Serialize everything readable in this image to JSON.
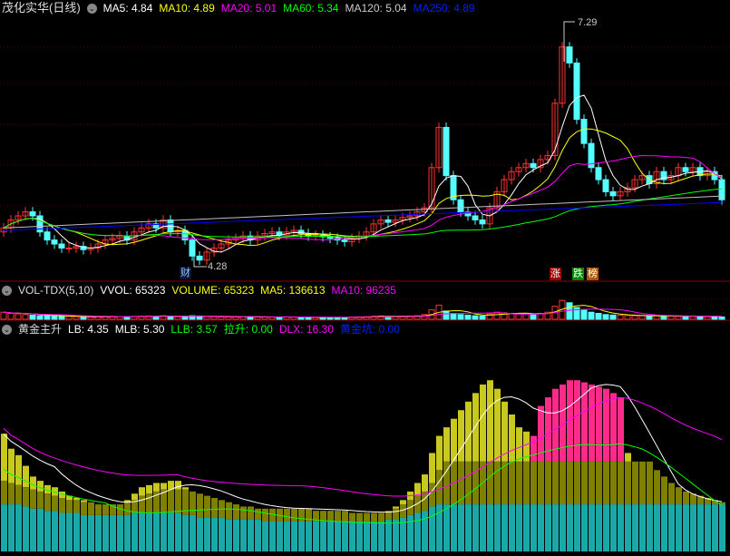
{
  "header": {
    "title": "茂化实华(日线)",
    "ma5": "MA5: 4.84",
    "ma10": "MA10: 4.89",
    "ma20": "MA20: 5.01",
    "ma60": "MA60: 5.34",
    "ma120": "MA120: 5.04",
    "ma250": "MA250: 4.89"
  },
  "vol_header": {
    "name": "VOL-TDX(5,10)",
    "vvol": "VVOL: 65323",
    "volume": "VOLUME: 65323",
    "ma5": "MA5: 136613",
    "ma10": "MA10: 96235"
  },
  "ind_header": {
    "name": "黄金主升",
    "lb": "LB: 4.35",
    "mlb": "MLB: 5.30",
    "llb": "LLB: 3.57",
    "ls": "拉升: 0.00",
    "dlx": "DLX: 16.30",
    "hjk": "黄金坑: 0.00"
  },
  "markers": {
    "high": "7.29",
    "low": "4.28",
    "cai": "财",
    "zhang": "涨",
    "die": "跌",
    "bang": "榜"
  },
  "colors": {
    "up": "#ff3232",
    "down": "#54ffff",
    "ma5": "#ffffff",
    "ma10": "#ffff00",
    "ma20": "#ff00ff",
    "ma60": "#00ff00",
    "ma120": "#c0c0c0",
    "ma250": "#0000ff"
  },
  "chart_data": {
    "type": "candlestick",
    "price_range": [
      4.28,
      7.29
    ],
    "closes": [
      4.75,
      4.85,
      4.9,
      4.95,
      4.9,
      4.7,
      4.6,
      4.55,
      4.5,
      4.5,
      4.52,
      4.48,
      4.5,
      4.55,
      4.6,
      4.62,
      4.65,
      4.6,
      4.7,
      4.75,
      4.8,
      4.75,
      4.85,
      4.7,
      4.72,
      4.6,
      4.4,
      4.35,
      4.45,
      4.5,
      4.55,
      4.6,
      4.62,
      4.65,
      4.6,
      4.65,
      4.68,
      4.7,
      4.66,
      4.7,
      4.72,
      4.68,
      4.65,
      4.66,
      4.64,
      4.62,
      4.6,
      4.58,
      4.62,
      4.65,
      4.7,
      4.8,
      4.85,
      4.82,
      4.85,
      4.88,
      4.9,
      4.95,
      5.0,
      5.5,
      6.0,
      5.4,
      5.1,
      4.95,
      4.9,
      4.85,
      4.8,
      5.0,
      5.2,
      5.35,
      5.45,
      5.5,
      5.55,
      5.5,
      5.6,
      5.65,
      6.3,
      7.0,
      6.8,
      6.1,
      5.8,
      5.5,
      5.35,
      5.2,
      5.15,
      5.2,
      5.25,
      5.35,
      5.4,
      5.3,
      5.45,
      5.35,
      5.4,
      5.5,
      5.45,
      5.5,
      5.4,
      5.45,
      5.35,
      5.1
    ],
    "volumes": [
      60,
      50,
      45,
      40,
      35,
      30,
      30,
      28,
      25,
      25,
      22,
      20,
      20,
      22,
      24,
      25,
      22,
      20,
      24,
      26,
      28,
      25,
      30,
      26,
      22,
      25,
      30,
      28,
      24,
      22,
      20,
      20,
      22,
      22,
      20,
      20,
      18,
      18,
      20,
      20,
      18,
      18,
      16,
      16,
      15,
      15,
      16,
      16,
      18,
      20,
      22,
      25,
      28,
      24,
      22,
      24,
      26,
      30,
      40,
      80,
      120,
      70,
      50,
      40,
      35,
      30,
      28,
      45,
      60,
      55,
      50,
      45,
      48,
      44,
      50,
      60,
      110,
      160,
      140,
      100,
      80,
      60,
      50,
      40,
      36,
      34,
      32,
      30,
      30,
      28,
      30,
      28,
      26,
      25,
      24,
      26,
      24,
      24,
      22,
      20
    ],
    "ind_teal": [
      22,
      22,
      22,
      21,
      20,
      20,
      19,
      19,
      18,
      18,
      18,
      17,
      17,
      17,
      17,
      17,
      17,
      17,
      18,
      18,
      18,
      18,
      18,
      18,
      18,
      17,
      17,
      16,
      16,
      16,
      16,
      15,
      15,
      15,
      15,
      15,
      14,
      14,
      14,
      14,
      14,
      14,
      14,
      14,
      14,
      14,
      14,
      14,
      14,
      14,
      14,
      14,
      14,
      15,
      15,
      16,
      17,
      18,
      19,
      21,
      22,
      22,
      22,
      22,
      22,
      22,
      22,
      22,
      22,
      22,
      22,
      22,
      22,
      22,
      22,
      22,
      22,
      22,
      22,
      22,
      22,
      22,
      22,
      22,
      22,
      22,
      22,
      22,
      22,
      22,
      22,
      22,
      22,
      22,
      22,
      22,
      22,
      22,
      22,
      22
    ],
    "ind_olive": [
      33,
      32,
      31,
      30,
      29,
      28,
      27,
      26,
      25,
      24,
      24,
      23,
      23,
      22,
      22,
      22,
      22,
      23,
      24,
      26,
      27,
      28,
      29,
      29,
      29,
      29,
      28,
      27,
      26,
      25,
      24,
      23,
      22,
      21,
      21,
      20,
      20,
      20,
      20,
      20,
      20,
      20,
      20,
      19,
      19,
      19,
      19,
      19,
      18,
      18,
      18,
      18,
      18,
      19,
      20,
      22,
      24,
      26,
      28,
      32,
      38,
      42,
      42,
      42,
      42,
      42,
      42,
      42,
      42,
      42,
      42,
      42,
      42,
      42,
      42,
      42,
      42,
      42,
      42,
      42,
      42,
      42,
      42,
      42,
      42,
      42,
      42,
      42,
      42,
      42,
      38,
      35,
      32,
      30,
      28,
      27,
      26,
      25,
      24,
      23
    ],
    "ind_top": [
      55,
      48,
      45,
      40,
      35,
      33,
      31,
      30,
      28,
      26,
      25,
      24,
      23,
      22,
      22,
      22,
      22,
      24,
      27,
      30,
      31,
      32,
      32,
      33,
      33,
      30,
      28,
      27,
      26,
      25,
      24,
      23,
      22,
      21,
      21,
      20,
      20,
      20,
      20,
      20,
      20,
      20,
      20,
      19,
      19,
      19,
      19,
      19,
      18,
      18,
      18,
      18,
      18,
      19,
      21,
      24,
      28,
      32,
      36,
      46,
      54,
      58,
      62,
      66,
      70,
      74,
      78,
      80,
      76,
      70,
      64,
      58,
      56,
      54,
      68,
      72,
      76,
      78,
      80,
      80,
      79,
      78,
      77,
      76,
      74,
      72,
      46,
      38,
      32,
      30,
      28,
      27,
      26,
      25,
      24,
      23,
      22,
      22,
      22,
      22
    ],
    "ind_pink_from": 73,
    "ind_pink_to": 85
  }
}
